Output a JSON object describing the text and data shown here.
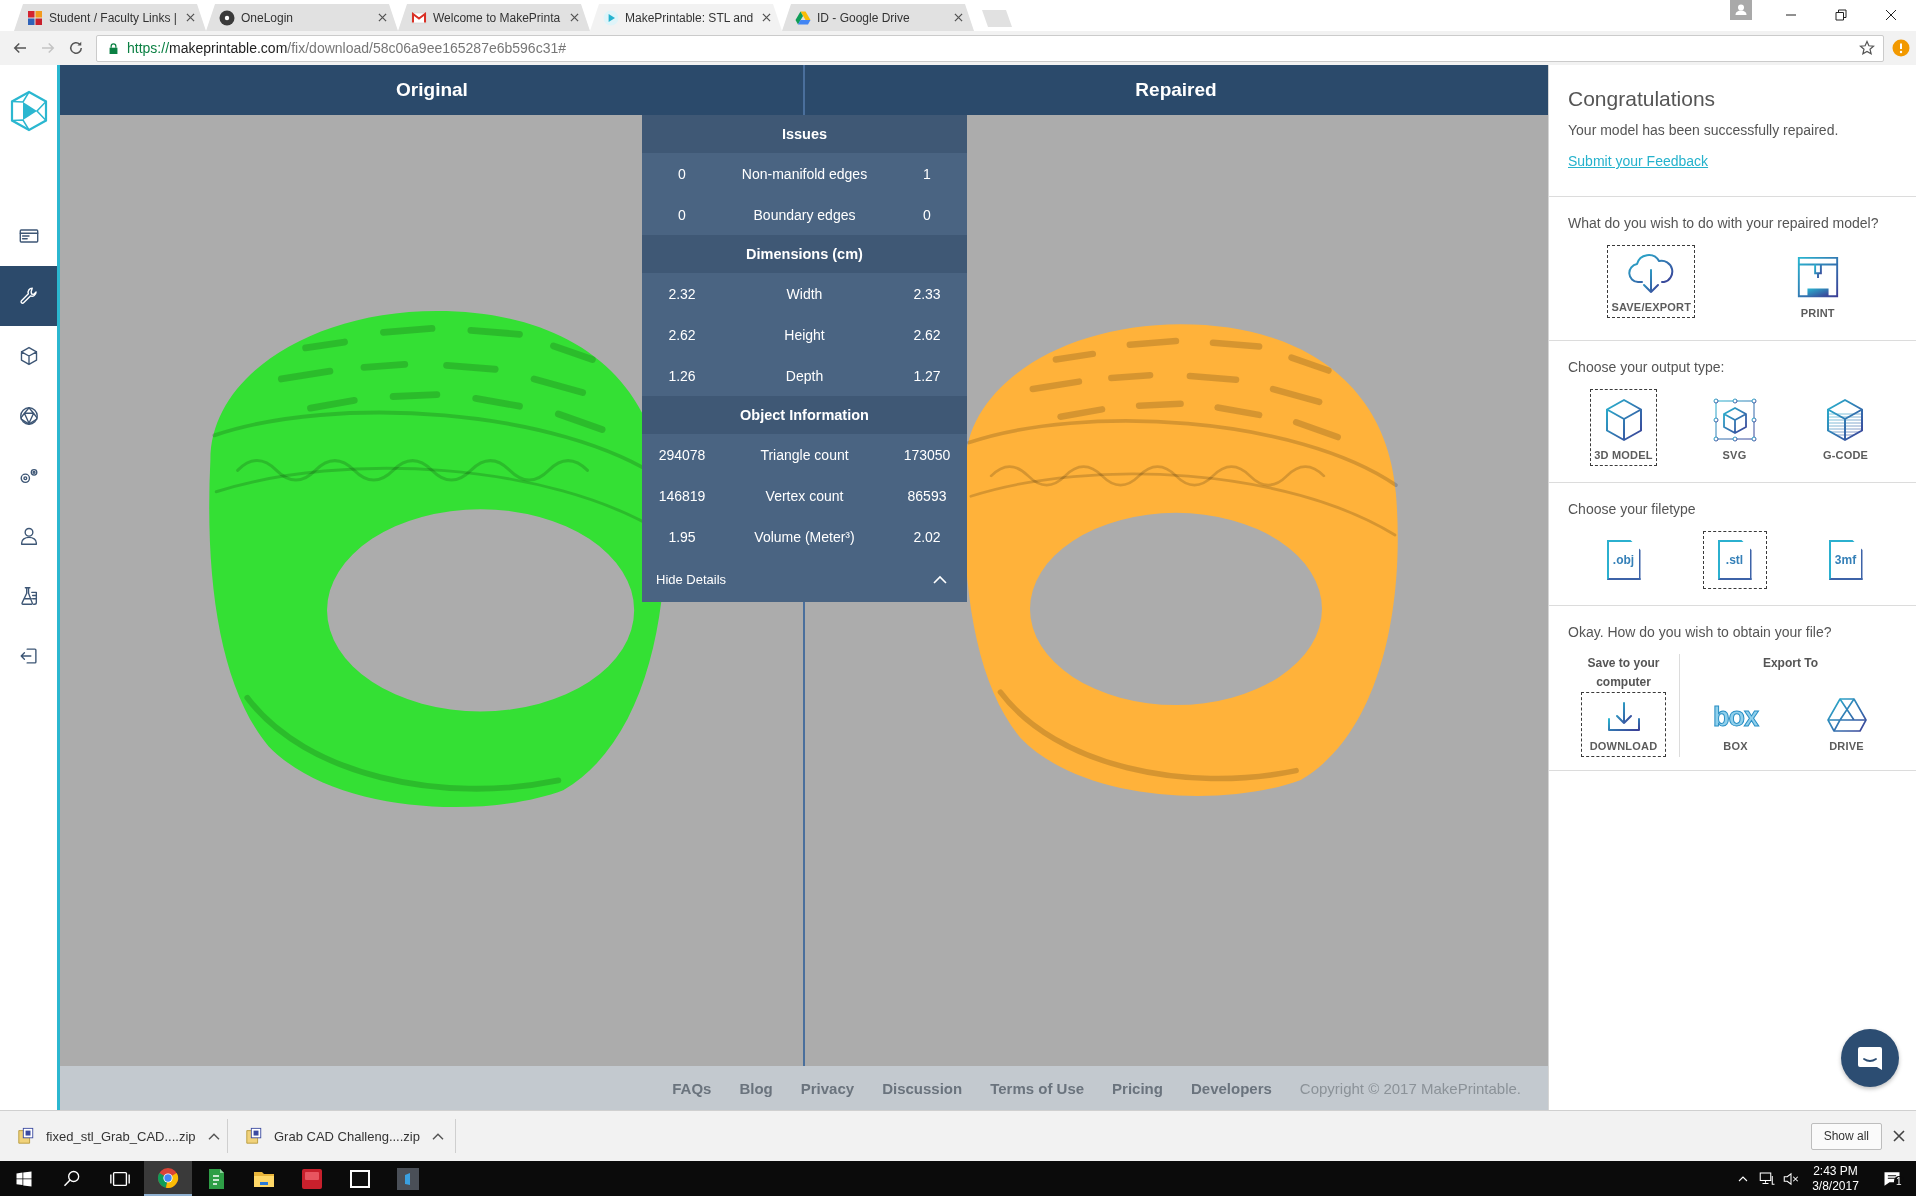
{
  "browser": {
    "tabs": [
      {
        "kind": "school",
        "title": "Student / Faculty Links |",
        "selected": false
      },
      {
        "kind": "badge",
        "title": "OneLogin",
        "selected": false
      },
      {
        "kind": "mail",
        "title": "Welcome to MakePrinta",
        "selected": false
      },
      {
        "kind": "play",
        "title": "MakePrintable: STL and",
        "selected": true
      },
      {
        "kind": "drive",
        "title": "ID - Google Drive",
        "selected": false
      }
    ],
    "address": {
      "scheme": "https://",
      "host": "makeprintable.com",
      "path": "/fix/download/58c06a9ee165287e6b596c31#"
    }
  },
  "sidebar": {
    "items": [
      {
        "kind": "card",
        "selected": false
      },
      {
        "kind": "wrench",
        "selected": true
      },
      {
        "kind": "cube",
        "selected": false
      },
      {
        "kind": "polyhedron",
        "selected": false
      },
      {
        "kind": "gears",
        "selected": false
      },
      {
        "kind": "user",
        "selected": false
      },
      {
        "kind": "flask",
        "selected": false
      },
      {
        "kind": "exit",
        "selected": false
      }
    ]
  },
  "viewer": {
    "panes": [
      {
        "title": "Original",
        "color": "#34e034"
      },
      {
        "title": "Repaired",
        "color": "#ffb23a"
      }
    ]
  },
  "details": {
    "sections": [
      {
        "title": "Issues",
        "rows": [
          {
            "original": "0",
            "label": "Non-manifold edges",
            "repaired": "1"
          },
          {
            "original": "0",
            "label": "Boundary edges",
            "repaired": "0"
          }
        ]
      },
      {
        "title": "Dimensions (cm)",
        "rows": [
          {
            "original": "2.32",
            "label": "Width",
            "repaired": "2.33"
          },
          {
            "original": "2.62",
            "label": "Height",
            "repaired": "2.62"
          },
          {
            "original": "1.26",
            "label": "Depth",
            "repaired": "1.27"
          }
        ]
      },
      {
        "title": "Object Information",
        "rows": [
          {
            "original": "294078",
            "label": "Triangle count",
            "repaired": "173050"
          },
          {
            "original": "146819",
            "label": "Vertex count",
            "repaired": "86593"
          },
          {
            "original": "1.95",
            "label": "Volume (Meter³)",
            "repaired": "2.02"
          }
        ]
      }
    ],
    "toggle": "Hide Details"
  },
  "footer": {
    "links": [
      "FAQs",
      "Blog",
      "Privacy",
      "Discussion",
      "Terms of Use",
      "Pricing",
      "Developers"
    ],
    "copyright": "Copyright © 2017 MakePrintable."
  },
  "panel": {
    "title": "Congratulations",
    "message": "Your model has been successfully repaired.",
    "feedback_link": "Submit your Feedback",
    "steps": [
      {
        "question": "What do you wish to do with your repaired model?",
        "options": [
          {
            "kind": "cloud",
            "label": "SAVE/EXPORT",
            "selected": true
          },
          {
            "kind": "printer",
            "label": "PRINT",
            "selected": false
          }
        ]
      },
      {
        "question": "Choose your output type:",
        "options": [
          {
            "kind": "cube",
            "label": "3D MODEL",
            "selected": true
          },
          {
            "kind": "cube-frame",
            "label": "SVG",
            "selected": false
          },
          {
            "kind": "cube-layers",
            "label": "G-CODE",
            "selected": false
          }
        ]
      },
      {
        "question": "Choose your filetype",
        "options": [
          {
            "kind": "file",
            "label": ".obj",
            "selected": false
          },
          {
            "kind": "file",
            "label": ".stl",
            "selected": true
          },
          {
            "kind": "file",
            "label": "3mf",
            "selected": false
          }
        ]
      }
    ],
    "obtain": {
      "question": "Okay. How do you wish to obtain your file?",
      "local": {
        "heading": "Save to your computer",
        "option": {
          "kind": "download",
          "label": "DOWNLOAD",
          "selected": true
        }
      },
      "export": {
        "heading": "Export To",
        "options": [
          {
            "kind": "wordmark",
            "logo": "box",
            "label": "BOX",
            "selected": false
          },
          {
            "kind": "triangle",
            "label": "DRIVE",
            "selected": false
          }
        ]
      }
    }
  },
  "downloads": {
    "items": [
      {
        "file": "fixed_stl_Grab_CAD....zip"
      },
      {
        "file": "Grab CAD Challeng....zip"
      }
    ],
    "show_all": "Show all"
  },
  "taskbar": {
    "apps": [
      {
        "kind": "browser",
        "active": true
      },
      {
        "kind": "project",
        "active": false
      },
      {
        "kind": "folder",
        "active": false
      },
      {
        "kind": "cad",
        "active": false
      },
      {
        "kind": "archive",
        "active": false
      },
      {
        "kind": "app",
        "active": false
      }
    ],
    "muted": true,
    "time": "2:43 PM",
    "date": "3/8/2017",
    "notifications": "1"
  }
}
